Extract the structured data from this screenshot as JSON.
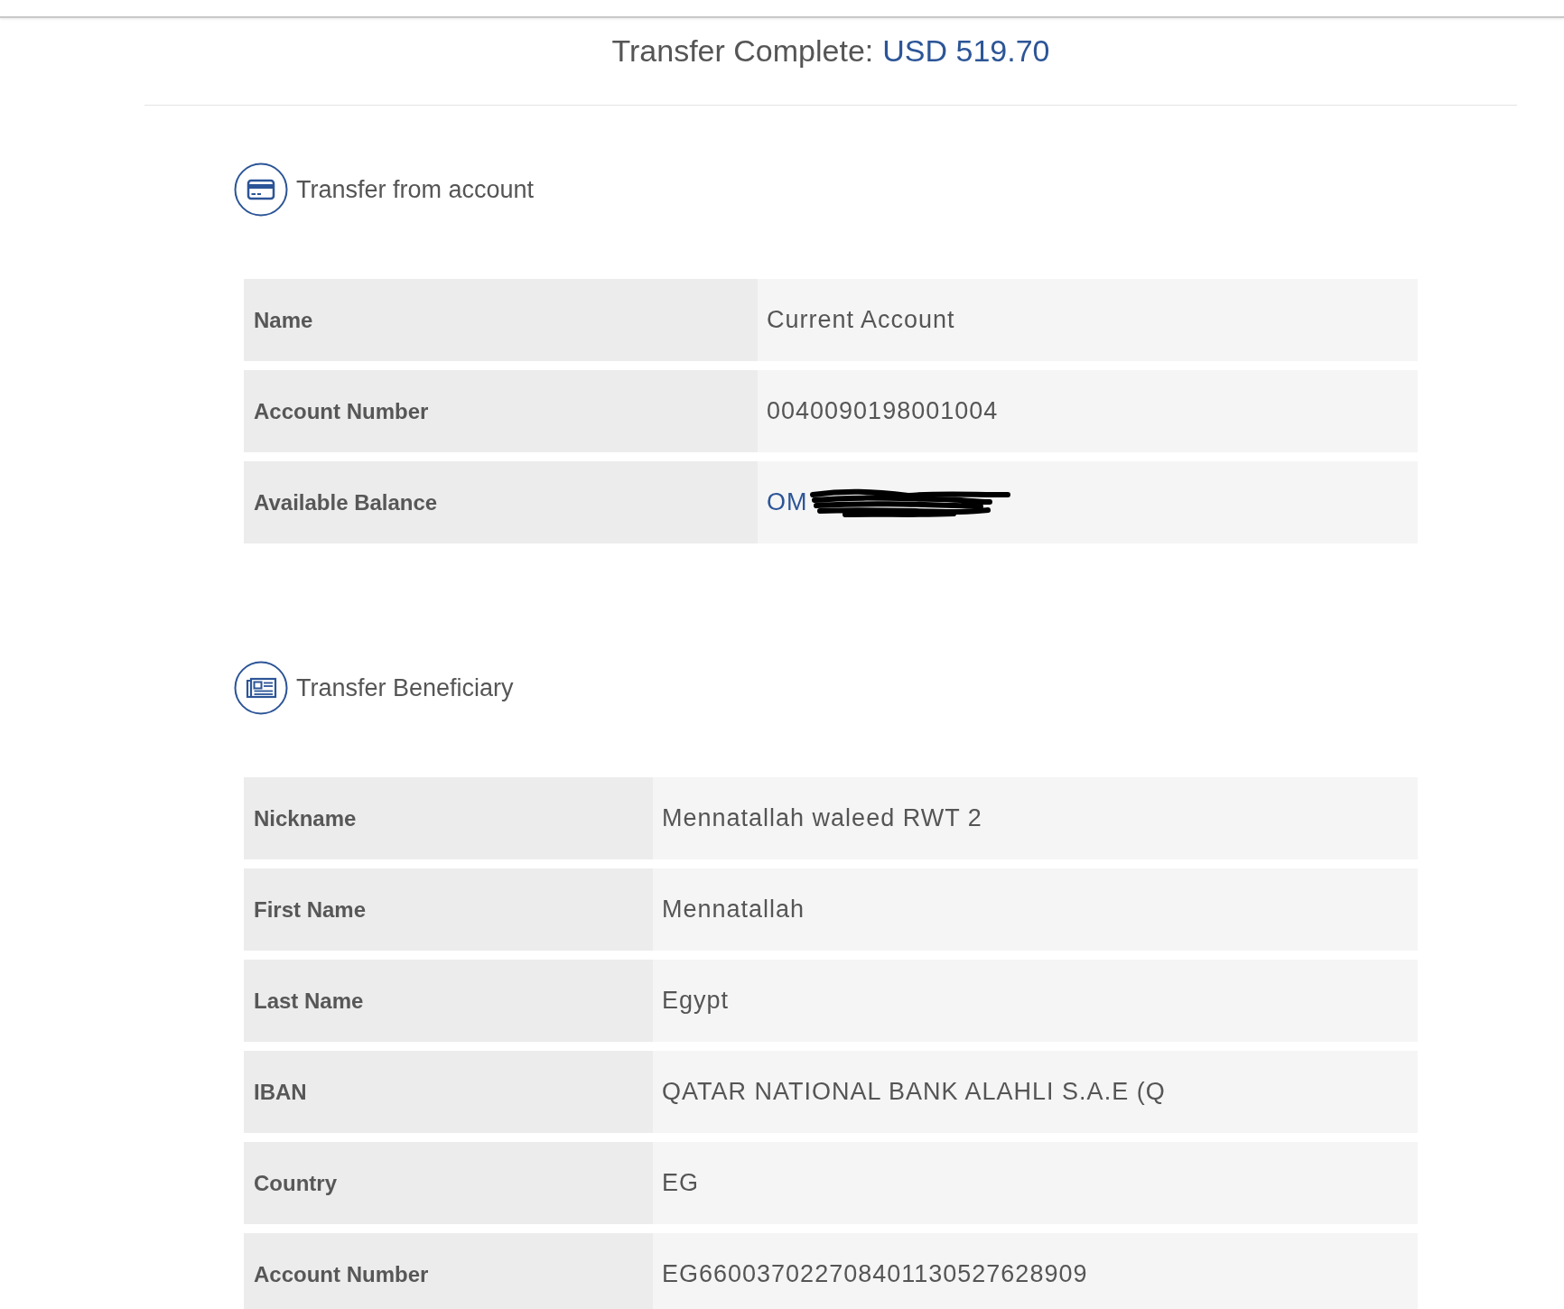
{
  "header": {
    "title": "Transfer Complete:",
    "amount": "USD 519.70"
  },
  "sections": [
    {
      "kind": "source",
      "title": "Transfer from account",
      "rows": [
        {
          "label": "Name",
          "value": "Current Account",
          "kind": "text",
          "redacted": false
        },
        {
          "label": "Account Number",
          "value": "0040090198001004",
          "kind": "text",
          "redacted": false
        },
        {
          "label": "Available Balance",
          "value": "OM",
          "kind": "amount",
          "redacted": true
        }
      ]
    },
    {
      "kind": "beneficiary",
      "title": "Transfer Beneficiary",
      "rows": [
        {
          "label": "Nickname",
          "value": "Mennatallah waleed RWT 2",
          "kind": "text",
          "redacted": false
        },
        {
          "label": "First Name",
          "value": "Mennatallah",
          "kind": "text",
          "redacted": false
        },
        {
          "label": "Last Name",
          "value": "Egypt",
          "kind": "text",
          "redacted": false
        },
        {
          "label": "IBAN",
          "value": "QATAR NATIONAL BANK ALAHLI S.A.E (Q",
          "kind": "text",
          "redacted": false
        },
        {
          "label": "Country",
          "value": "EG",
          "kind": "text",
          "redacted": false
        },
        {
          "label": "Account Number",
          "value": "EG660037022708401130527628909",
          "kind": "text",
          "redacted": false
        }
      ]
    }
  ]
}
